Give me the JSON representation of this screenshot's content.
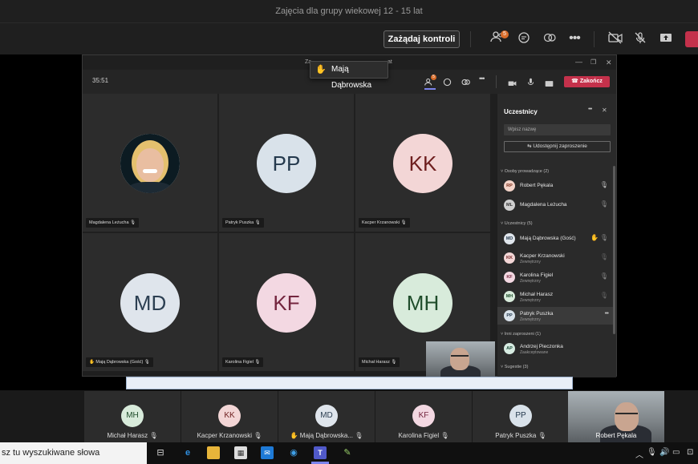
{
  "window": {
    "title": "Zajęcia dla grupy wiekowej 12 - 15 lat"
  },
  "toolbar": {
    "request_control_label": "Zażądaj kontroli",
    "participants_badge": "5"
  },
  "inner": {
    "title_prefix": "Za",
    "title_suffix": "at",
    "timer": "35:51",
    "leave_label": "Zakończ",
    "participants_badge": "5",
    "raised_hand_name": "Mają Dąbrowska"
  },
  "grid": [
    {
      "name": "Magdalena Leżucha",
      "initials": "",
      "bg": "#ffffff",
      "fg": "#000000",
      "photo": true
    },
    {
      "name": "Patryk Puszka",
      "initials": "PP",
      "bg": "#d9e2ea",
      "fg": "#24394d"
    },
    {
      "name": "Kacper Krzanowski",
      "initials": "KK",
      "bg": "#f3d6d6",
      "fg": "#6e1f1f"
    },
    {
      "name": "Mają Dąbrowska (Gość)",
      "initials": "MD",
      "bg": "#dfe5ec",
      "fg": "#2c3f52",
      "hand": true
    },
    {
      "name": "Karolina Figiel",
      "initials": "KF",
      "bg": "#f3d8e2",
      "fg": "#74263f"
    },
    {
      "name": "Michał Harasz",
      "initials": "MH",
      "bg": "#d8ebdb",
      "fg": "#1f4d2b"
    }
  ],
  "panel": {
    "title": "Uczestnicy",
    "search_placeholder": "Wpisz nazwę",
    "share_label": "Udostępnij zaproszenie",
    "sections": {
      "presenters": "Osoby prowadzące (2)",
      "attendees": "Uczestnicy (5)",
      "invited": "Inni zaproszeni (1)",
      "suggested": "Sugestie (3)"
    },
    "presenters": [
      {
        "name": "Robert Pękala",
        "initials": "RP",
        "bg": "#f3d3c8",
        "fg": "#7a2e1a",
        "sub": ""
      },
      {
        "name": "Magdalena Leżucha",
        "initials": "ML",
        "bg": "#cfcfcf",
        "fg": "#333333",
        "sub": ""
      }
    ],
    "attendees": [
      {
        "name": "Mają Dąbrowska (Gość)",
        "initials": "MD",
        "bg": "#dfe5ec",
        "fg": "#2c3f52",
        "sub": ""
      },
      {
        "name": "Kacper Krzanowski",
        "initials": "KK",
        "bg": "#f3d6d6",
        "fg": "#6e1f1f",
        "sub": "Zewnętrzny"
      },
      {
        "name": "Karolina Figiel",
        "initials": "KF",
        "bg": "#f3d8e2",
        "fg": "#74263f",
        "sub": "Zewnętrzny"
      },
      {
        "name": "Michał Harasz",
        "initials": "MH",
        "bg": "#d8ebdb",
        "fg": "#1f4d2b",
        "sub": "Zewnętrzny"
      },
      {
        "name": "Patryk Puszka",
        "initials": "PP",
        "bg": "#d9e2ea",
        "fg": "#24394d",
        "sub": "Zewnętrzny"
      }
    ],
    "invited": [
      {
        "name": "Andrzej Pieczonka",
        "initials": "AP",
        "bg": "#d6ebe1",
        "fg": "#1f4d3a",
        "sub": "Zaakceptowane"
      }
    ]
  },
  "strip": [
    {
      "name": "Michał Harasz",
      "initials": "MH",
      "bg": "#d8ebdb",
      "fg": "#1f4d2b"
    },
    {
      "name": "Kacper Krzanowski",
      "initials": "KK",
      "bg": "#f3d6d6",
      "fg": "#6e1f1f"
    },
    {
      "name": "Mają Dąbrowska...",
      "initials": "MD",
      "bg": "#dfe5ec",
      "fg": "#2c3f52",
      "hand": true
    },
    {
      "name": "Karolina Figiel",
      "initials": "KF",
      "bg": "#f3d8e2",
      "fg": "#74263f"
    },
    {
      "name": "Patryk Puszka",
      "initials": "PP",
      "bg": "#d9e2ea",
      "fg": "#24394d"
    },
    {
      "name": "Robert Pękala",
      "initials": "",
      "bg": "",
      "fg": "",
      "video": true
    }
  ],
  "taskbar": {
    "search_text": "sz tu wyszukiwane słowa"
  }
}
